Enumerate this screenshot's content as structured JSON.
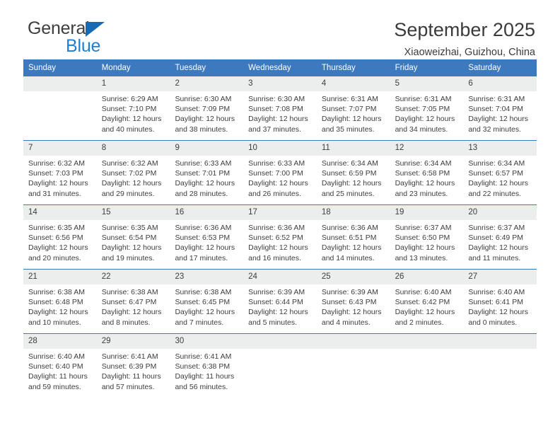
{
  "logo": {
    "word_top": "General",
    "word_bottom": "Blue",
    "triangle_icon": "triangle-icon",
    "color_top": "#3f3f3f",
    "color_bottom": "#1f7fd4",
    "color_triangle": "#1a6ab3"
  },
  "header": {
    "title": "September 2025",
    "subtitle": "Xiaoweizhai, Guizhou, China"
  },
  "colors": {
    "header_blue": "#3c79be",
    "daynum_band": "#eceded",
    "text": "#3d3d3d"
  },
  "weekday_headers": [
    "Sunday",
    "Monday",
    "Tuesday",
    "Wednesday",
    "Thursday",
    "Friday",
    "Saturday"
  ],
  "weeks": [
    {
      "days": [
        {
          "day": "",
          "sunrise": "",
          "sunset": "",
          "daylight_line1": "",
          "daylight_line2": "",
          "empty": true
        },
        {
          "day": "1",
          "sunrise": "Sunrise: 6:29 AM",
          "sunset": "Sunset: 7:10 PM",
          "daylight_line1": "Daylight: 12 hours",
          "daylight_line2": "and 40 minutes."
        },
        {
          "day": "2",
          "sunrise": "Sunrise: 6:30 AM",
          "sunset": "Sunset: 7:09 PM",
          "daylight_line1": "Daylight: 12 hours",
          "daylight_line2": "and 38 minutes."
        },
        {
          "day": "3",
          "sunrise": "Sunrise: 6:30 AM",
          "sunset": "Sunset: 7:08 PM",
          "daylight_line1": "Daylight: 12 hours",
          "daylight_line2": "and 37 minutes."
        },
        {
          "day": "4",
          "sunrise": "Sunrise: 6:31 AM",
          "sunset": "Sunset: 7:07 PM",
          "daylight_line1": "Daylight: 12 hours",
          "daylight_line2": "and 35 minutes."
        },
        {
          "day": "5",
          "sunrise": "Sunrise: 6:31 AM",
          "sunset": "Sunset: 7:05 PM",
          "daylight_line1": "Daylight: 12 hours",
          "daylight_line2": "and 34 minutes."
        },
        {
          "day": "6",
          "sunrise": "Sunrise: 6:31 AM",
          "sunset": "Sunset: 7:04 PM",
          "daylight_line1": "Daylight: 12 hours",
          "daylight_line2": "and 32 minutes."
        }
      ]
    },
    {
      "days": [
        {
          "day": "7",
          "sunrise": "Sunrise: 6:32 AM",
          "sunset": "Sunset: 7:03 PM",
          "daylight_line1": "Daylight: 12 hours",
          "daylight_line2": "and 31 minutes."
        },
        {
          "day": "8",
          "sunrise": "Sunrise: 6:32 AM",
          "sunset": "Sunset: 7:02 PM",
          "daylight_line1": "Daylight: 12 hours",
          "daylight_line2": "and 29 minutes."
        },
        {
          "day": "9",
          "sunrise": "Sunrise: 6:33 AM",
          "sunset": "Sunset: 7:01 PM",
          "daylight_line1": "Daylight: 12 hours",
          "daylight_line2": "and 28 minutes."
        },
        {
          "day": "10",
          "sunrise": "Sunrise: 6:33 AM",
          "sunset": "Sunset: 7:00 PM",
          "daylight_line1": "Daylight: 12 hours",
          "daylight_line2": "and 26 minutes."
        },
        {
          "day": "11",
          "sunrise": "Sunrise: 6:34 AM",
          "sunset": "Sunset: 6:59 PM",
          "daylight_line1": "Daylight: 12 hours",
          "daylight_line2": "and 25 minutes."
        },
        {
          "day": "12",
          "sunrise": "Sunrise: 6:34 AM",
          "sunset": "Sunset: 6:58 PM",
          "daylight_line1": "Daylight: 12 hours",
          "daylight_line2": "and 23 minutes."
        },
        {
          "day": "13",
          "sunrise": "Sunrise: 6:34 AM",
          "sunset": "Sunset: 6:57 PM",
          "daylight_line1": "Daylight: 12 hours",
          "daylight_line2": "and 22 minutes."
        }
      ]
    },
    {
      "days": [
        {
          "day": "14",
          "sunrise": "Sunrise: 6:35 AM",
          "sunset": "Sunset: 6:56 PM",
          "daylight_line1": "Daylight: 12 hours",
          "daylight_line2": "and 20 minutes."
        },
        {
          "day": "15",
          "sunrise": "Sunrise: 6:35 AM",
          "sunset": "Sunset: 6:54 PM",
          "daylight_line1": "Daylight: 12 hours",
          "daylight_line2": "and 19 minutes."
        },
        {
          "day": "16",
          "sunrise": "Sunrise: 6:36 AM",
          "sunset": "Sunset: 6:53 PM",
          "daylight_line1": "Daylight: 12 hours",
          "daylight_line2": "and 17 minutes."
        },
        {
          "day": "17",
          "sunrise": "Sunrise: 6:36 AM",
          "sunset": "Sunset: 6:52 PM",
          "daylight_line1": "Daylight: 12 hours",
          "daylight_line2": "and 16 minutes."
        },
        {
          "day": "18",
          "sunrise": "Sunrise: 6:36 AM",
          "sunset": "Sunset: 6:51 PM",
          "daylight_line1": "Daylight: 12 hours",
          "daylight_line2": "and 14 minutes."
        },
        {
          "day": "19",
          "sunrise": "Sunrise: 6:37 AM",
          "sunset": "Sunset: 6:50 PM",
          "daylight_line1": "Daylight: 12 hours",
          "daylight_line2": "and 13 minutes."
        },
        {
          "day": "20",
          "sunrise": "Sunrise: 6:37 AM",
          "sunset": "Sunset: 6:49 PM",
          "daylight_line1": "Daylight: 12 hours",
          "daylight_line2": "and 11 minutes."
        }
      ]
    },
    {
      "days": [
        {
          "day": "21",
          "sunrise": "Sunrise: 6:38 AM",
          "sunset": "Sunset: 6:48 PM",
          "daylight_line1": "Daylight: 12 hours",
          "daylight_line2": "and 10 minutes."
        },
        {
          "day": "22",
          "sunrise": "Sunrise: 6:38 AM",
          "sunset": "Sunset: 6:47 PM",
          "daylight_line1": "Daylight: 12 hours",
          "daylight_line2": "and 8 minutes."
        },
        {
          "day": "23",
          "sunrise": "Sunrise: 6:38 AM",
          "sunset": "Sunset: 6:45 PM",
          "daylight_line1": "Daylight: 12 hours",
          "daylight_line2": "and 7 minutes."
        },
        {
          "day": "24",
          "sunrise": "Sunrise: 6:39 AM",
          "sunset": "Sunset: 6:44 PM",
          "daylight_line1": "Daylight: 12 hours",
          "daylight_line2": "and 5 minutes."
        },
        {
          "day": "25",
          "sunrise": "Sunrise: 6:39 AM",
          "sunset": "Sunset: 6:43 PM",
          "daylight_line1": "Daylight: 12 hours",
          "daylight_line2": "and 4 minutes."
        },
        {
          "day": "26",
          "sunrise": "Sunrise: 6:40 AM",
          "sunset": "Sunset: 6:42 PM",
          "daylight_line1": "Daylight: 12 hours",
          "daylight_line2": "and 2 minutes."
        },
        {
          "day": "27",
          "sunrise": "Sunrise: 6:40 AM",
          "sunset": "Sunset: 6:41 PM",
          "daylight_line1": "Daylight: 12 hours",
          "daylight_line2": "and 0 minutes."
        }
      ]
    },
    {
      "days": [
        {
          "day": "28",
          "sunrise": "Sunrise: 6:40 AM",
          "sunset": "Sunset: 6:40 PM",
          "daylight_line1": "Daylight: 11 hours",
          "daylight_line2": "and 59 minutes."
        },
        {
          "day": "29",
          "sunrise": "Sunrise: 6:41 AM",
          "sunset": "Sunset: 6:39 PM",
          "daylight_line1": "Daylight: 11 hours",
          "daylight_line2": "and 57 minutes."
        },
        {
          "day": "30",
          "sunrise": "Sunrise: 6:41 AM",
          "sunset": "Sunset: 6:38 PM",
          "daylight_line1": "Daylight: 11 hours",
          "daylight_line2": "and 56 minutes."
        },
        {
          "day": "",
          "sunrise": "",
          "sunset": "",
          "daylight_line1": "",
          "daylight_line2": "",
          "empty": true
        },
        {
          "day": "",
          "sunrise": "",
          "sunset": "",
          "daylight_line1": "",
          "daylight_line2": "",
          "empty": true
        },
        {
          "day": "",
          "sunrise": "",
          "sunset": "",
          "daylight_line1": "",
          "daylight_line2": "",
          "empty": true
        },
        {
          "day": "",
          "sunrise": "",
          "sunset": "",
          "daylight_line1": "",
          "daylight_line2": "",
          "empty": true
        }
      ]
    }
  ]
}
